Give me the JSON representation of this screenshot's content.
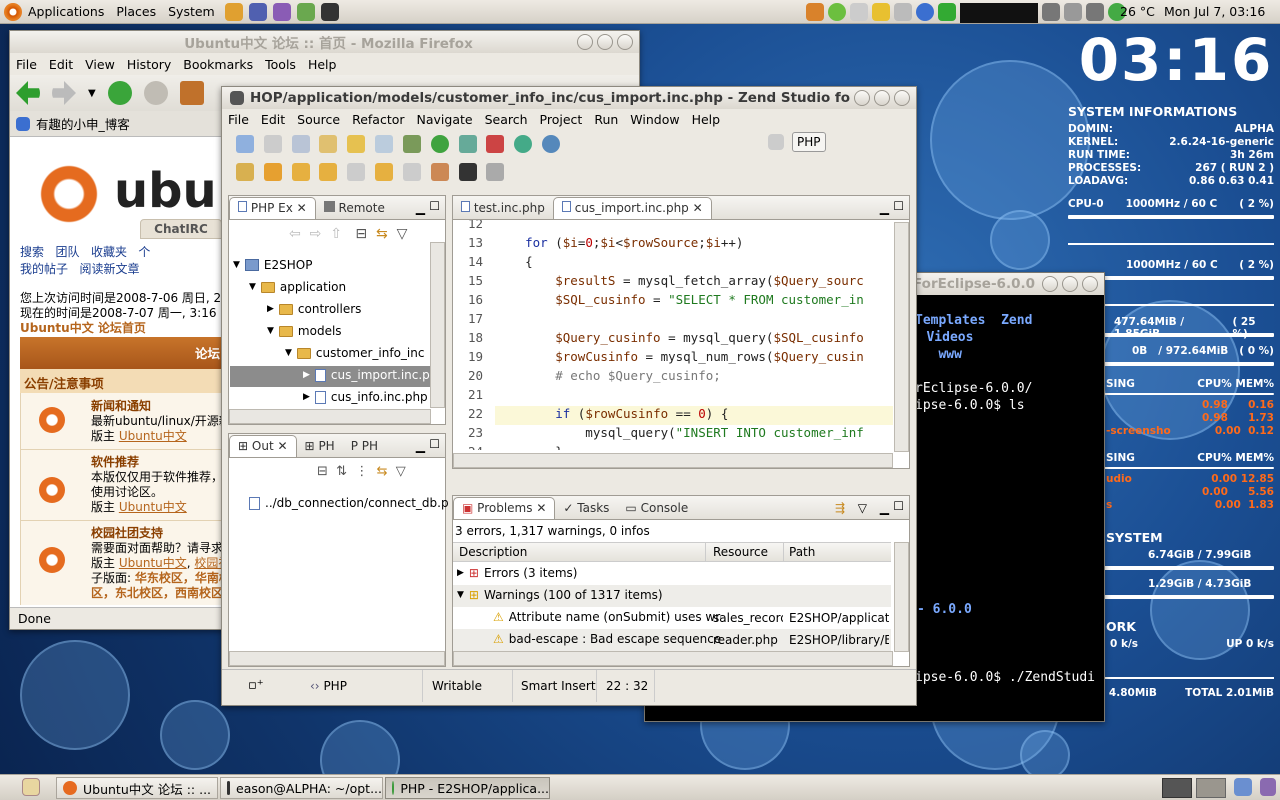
{
  "top_panel": {
    "applications": "Applications",
    "places": "Places",
    "system": "System",
    "temperature": "26 °C",
    "clock": "Mon Jul  7, 03:16"
  },
  "conky": {
    "time": "03:16",
    "sys_header": "SYSTEM INFORMATIONS",
    "domin_label": "DOMIN:",
    "domin": "ALPHA",
    "kernel_label": "KERNEL:",
    "kernel": "2.6.24-16-generic",
    "runtime_label": "RUN TIME:",
    "runtime": "3h 26m",
    "processes_label": "PROCESSES:",
    "processes": "267  ( RUN 2 )",
    "loadavg_label": "LOADAVG:",
    "loadavg": "0.86 0.63 0.41",
    "cpu0_label": "CPU-0",
    "cpu0": "1000MHz / 60  C",
    "cpu0_pct": "( 2  %)",
    "cpu1": "1000MHz / 60  C",
    "cpu1_pct": "( 2  %)",
    "mem": "477.64MiB / 1.85GiB",
    "mem_pct": "( 25 %)",
    "swap_a": "0B",
    "swap": "/ 972.64MiB",
    "swap_pct": "( 0 %)",
    "sing1": "SING",
    "cpumem1": "CPU% MEM%",
    "p1": [
      "0.98",
      "0.16"
    ],
    "p2": [
      "0.98",
      "1.73"
    ],
    "p3_name": "-screensho",
    "p3": [
      "0.00",
      "0.12"
    ],
    "sing2": "SING",
    "cpumem2": "CPU% MEM%",
    "q1_name": "udio",
    "q1": [
      "0.00",
      "12.85"
    ],
    "q2": [
      "0.00",
      "5.56"
    ],
    "q3_name": "s",
    "q3": [
      "0.00",
      "1.83"
    ],
    "fs_header": "SYSTEM",
    "fs1": "6.74GiB  / 7.99GiB",
    "fs2": "1.29GiB  / 4.73GiB",
    "net_header": "ORK",
    "down": "0   k/s",
    "up_label": "UP",
    "up": "0   k/s",
    "total_down": "TOTAL 4.80MiB",
    "total_up": "TOTAL 2.01MiB"
  },
  "firefox": {
    "title": "Ubuntu中文 论坛 :: 首页 - Mozilla Firefox",
    "menu": [
      "File",
      "Edit",
      "View",
      "History",
      "Bookmarks",
      "Tools",
      "Help"
    ],
    "tab": "有趣的小申_博客",
    "logo_text": "ubu",
    "chatirc": "ChatIRC",
    "links1": [
      "搜索",
      "团队",
      "收藏夹",
      "个"
    ],
    "links2": [
      "我的帖子",
      "阅读新文章"
    ],
    "visit1": "您上次访问时间是2008-7-06 周日, 2",
    "visit2": "现在的时间是2008-7-07 周一, 3:16",
    "forum_home": "Ubuntu中文 论坛首页",
    "forum_header": "论坛",
    "notice": "公告/注意事项",
    "f1_title": "新闻和通知",
    "f1_desc": "最新ubuntu/linux/开源新",
    "f1_mod_label": "版主",
    "f1_mod": "Ubuntu中文",
    "f2_title": "软件推荐",
    "f2_desc1": "本版仅仅用于软件推荐，不",
    "f2_desc2": "使用讨论区。",
    "f2_mod_label": "版主",
    "f2_mod": "Ubuntu中文",
    "f3_title": "校园社团支持",
    "f3_desc": "需要面对面帮助？请寻求当",
    "f3_mod_label": "版主",
    "f3_mod": "Ubuntu中文",
    "f3_mod2": "校园社",
    "f3_sub_label": "子版面:",
    "f3_sub": "华东校区，华南校",
    "f3_sub2": "区，东北校区，西南校区",
    "status": "Done"
  },
  "terminal": {
    "title": "ForEclipse-6.0.0",
    "lines": [
      "Templates  Zend",
      "s  Videos",
      "   www",
      "rEclipse-6.0.0/",
      "ipse-6.0.0$ ls",
      "- 6.0.0",
      "ipse-6.0.0$ ./ZendStudi"
    ]
  },
  "zend": {
    "title": "HOP/application/models/customer_info_inc/cus_import.inc.php - Zend Studio fo",
    "menu": [
      "File",
      "Edit",
      "Source",
      "Refactor",
      "Navigate",
      "Search",
      "Project",
      "Run",
      "Window",
      "Help"
    ],
    "perspective": "PHP",
    "explorer_tabs": [
      "PHP Ex",
      "Remote"
    ],
    "tree": {
      "root": "E2SHOP",
      "application": "application",
      "controllers": "controllers",
      "models": "models",
      "customer_info": "customer_info_inc",
      "file1": "cus_import.inc.p",
      "file2": "cus_info.inc.php"
    },
    "outline_tabs": [
      "Out",
      "PH",
      "PH"
    ],
    "outline_item": "../db_connection/connect_db.p",
    "editor_tabs": [
      "test.inc.php",
      "cus_import.inc.php"
    ],
    "code": [
      {
        "n": "12",
        "t": ""
      },
      {
        "n": "13",
        "t": "    for ($i=0;$i<$rowSource;$i++)"
      },
      {
        "n": "14",
        "t": "    {"
      },
      {
        "n": "15",
        "t": "        $resultS = mysql_fetch_array($Query_sourc"
      },
      {
        "n": "16",
        "t": "        $SQL_cusinfo = \"SELECT * FROM customer_in"
      },
      {
        "n": "17",
        "t": ""
      },
      {
        "n": "18",
        "t": "        $Query_cusinfo = mysql_query($SQL_cusinfo"
      },
      {
        "n": "19",
        "t": "        $rowCusinfo = mysql_num_rows($Query_cusin"
      },
      {
        "n": "20",
        "t": "        # echo $Query_cusinfo;"
      },
      {
        "n": "21",
        "t": ""
      },
      {
        "n": "22",
        "t": "        if ($rowCusinfo == 0) {"
      },
      {
        "n": "23",
        "t": "            mysql_query(\"INSERT INTO customer_inf"
      },
      {
        "n": "24",
        "t": "        }"
      }
    ],
    "bottom_tabs": [
      "Problems",
      "Tasks",
      "Console"
    ],
    "problems_summary": "3 errors, 1,317 warnings, 0 infos",
    "cols": [
      "Description",
      "Resource",
      "Path"
    ],
    "errors": "Errors (3 items)",
    "warnings": "Warnings (100 of 1317 items)",
    "w1": {
      "desc": "Attribute name (onSubmit) uses wrc",
      "res": "sales_record_",
      "path": "E2SHOP/applicatio"
    },
    "w2": {
      "desc": "bad-escape : Bad escape sequence:",
      "res": "reader.php",
      "path": "E2SHOP/library/Exc"
    },
    "status": {
      "lang": "PHP",
      "mode": "Writable",
      "insert": "Smart Insert",
      "pos": "22 : 32"
    }
  },
  "taskbar": [
    "Ubuntu中文 论坛 :: ...",
    "eason@ALPHA: ~/opt...",
    "PHP - E2SHOP/applica..."
  ]
}
